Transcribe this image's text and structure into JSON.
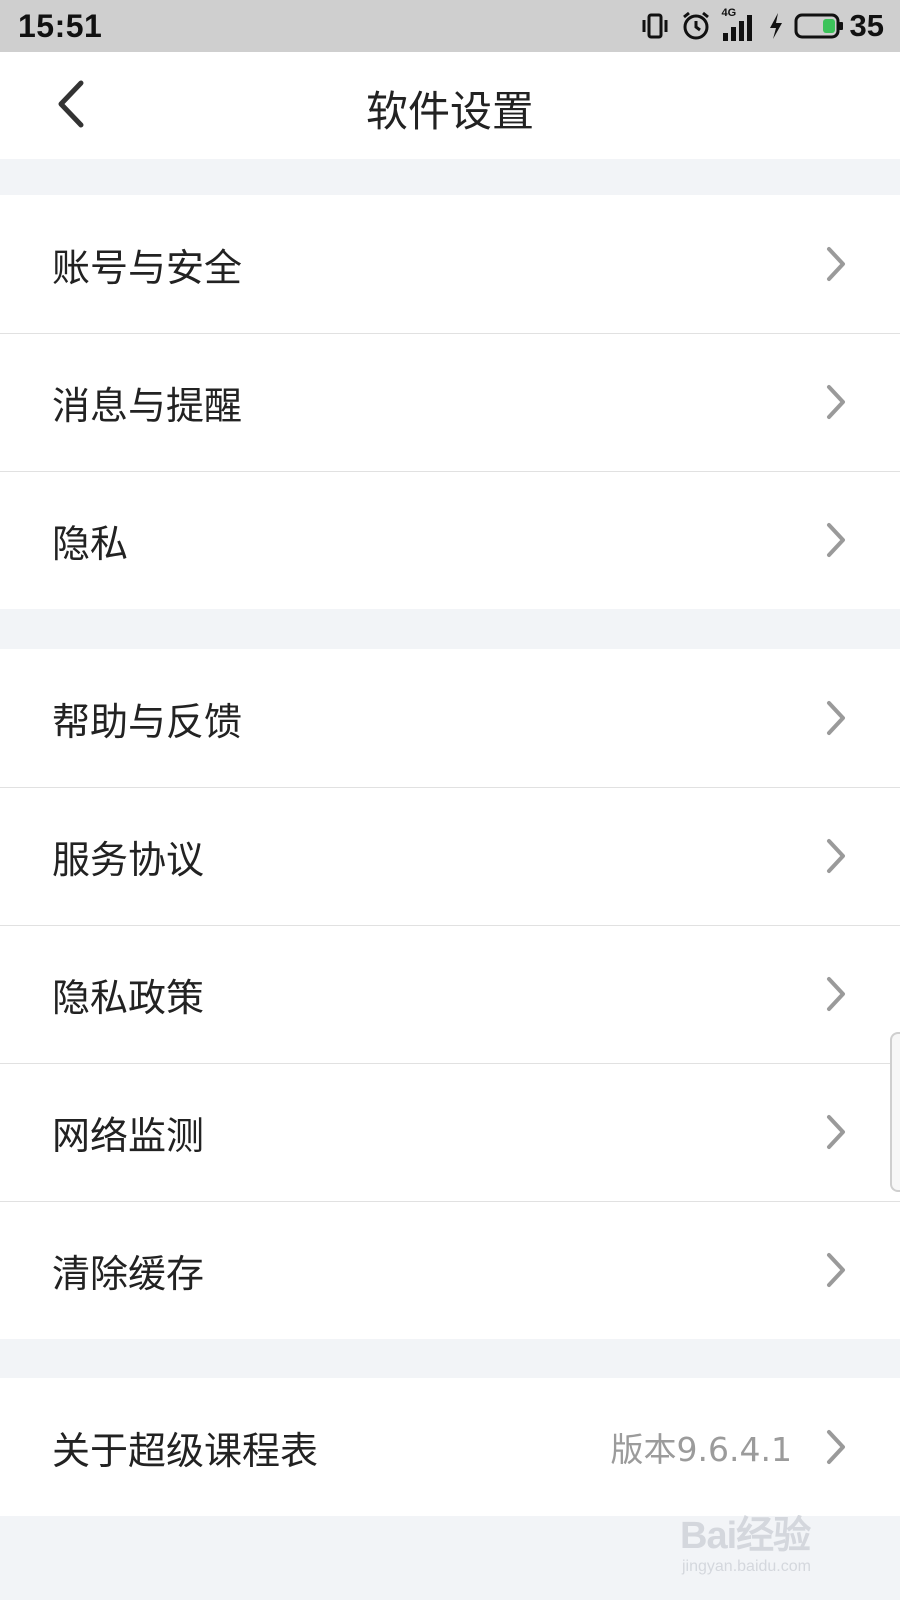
{
  "status_bar": {
    "time": "15:51",
    "network_label": "4G",
    "battery_percent": "35",
    "icons": [
      "vibrate-icon",
      "alarm-icon",
      "signal-icon",
      "charging-icon",
      "battery-icon"
    ]
  },
  "header": {
    "title": "软件设置",
    "back_icon": "chevron-left-icon"
  },
  "groups": [
    {
      "items": [
        {
          "label": "账号与安全"
        },
        {
          "label": "消息与提醒"
        },
        {
          "label": "隐私"
        }
      ]
    },
    {
      "items": [
        {
          "label": "帮助与反馈"
        },
        {
          "label": "服务协议"
        },
        {
          "label": "隐私政策"
        },
        {
          "label": "网络监测"
        },
        {
          "label": "清除缓存"
        }
      ]
    },
    {
      "items": [
        {
          "label": "关于超级课程表",
          "value": "版本9.6.4.1"
        }
      ]
    }
  ],
  "watermark": {
    "brand": "Bai经验",
    "url": "jingyan.baidu.com"
  },
  "colors": {
    "status_bar_bg": "#cfcfcf",
    "page_bg": "#f2f4f7",
    "battery_fill": "#3cc35a",
    "chevron": "#9a9a9a"
  }
}
